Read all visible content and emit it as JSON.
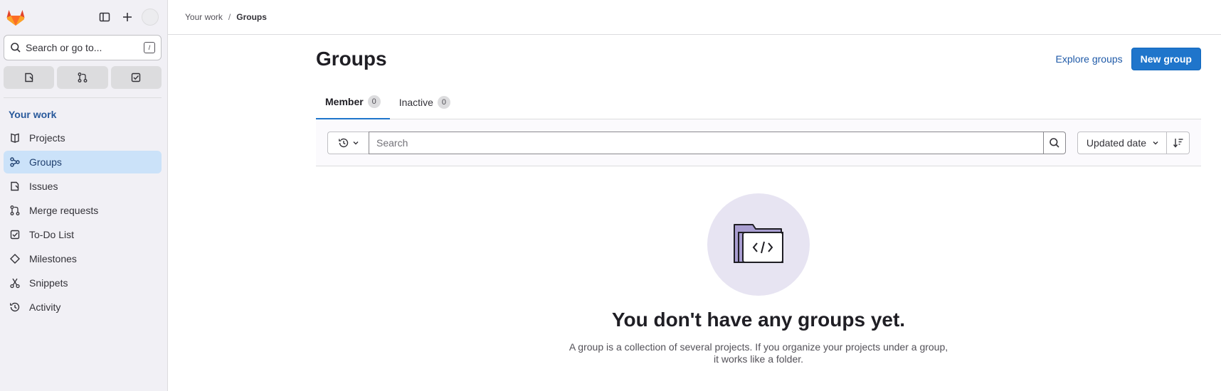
{
  "sidebar": {
    "search_placeholder": "Search or go to...",
    "search_shortcut": "/",
    "section_heading": "Your work",
    "items": [
      {
        "label": "Projects",
        "icon": "project-icon"
      },
      {
        "label": "Groups",
        "icon": "group-icon",
        "active": true
      },
      {
        "label": "Issues",
        "icon": "issues-icon"
      },
      {
        "label": "Merge requests",
        "icon": "merge-request-icon"
      },
      {
        "label": "To-Do List",
        "icon": "todo-icon"
      },
      {
        "label": "Milestones",
        "icon": "milestone-icon"
      },
      {
        "label": "Snippets",
        "icon": "snippet-icon"
      },
      {
        "label": "Activity",
        "icon": "history-icon"
      }
    ]
  },
  "breadcrumb": {
    "parent": "Your work",
    "separator": "/",
    "current": "Groups"
  },
  "page": {
    "title": "Groups",
    "explore_label": "Explore groups",
    "new_group_label": "New group"
  },
  "tabs": [
    {
      "label": "Member",
      "count": "0",
      "active": true
    },
    {
      "label": "Inactive",
      "count": "0",
      "active": false
    }
  ],
  "filter": {
    "search_placeholder": "Search",
    "sort_label": "Updated date"
  },
  "empty_state": {
    "title": "You don't have any groups yet.",
    "description": "A group is a collection of several projects. If you organize your projects under a group, it works like a folder."
  },
  "colors": {
    "accent": "#1f75cb",
    "sidebar_bg": "#f1f0f5",
    "active_item_bg": "#cbe2f9",
    "heading_link": "#28599b",
    "logo_orange": "#e24329"
  }
}
